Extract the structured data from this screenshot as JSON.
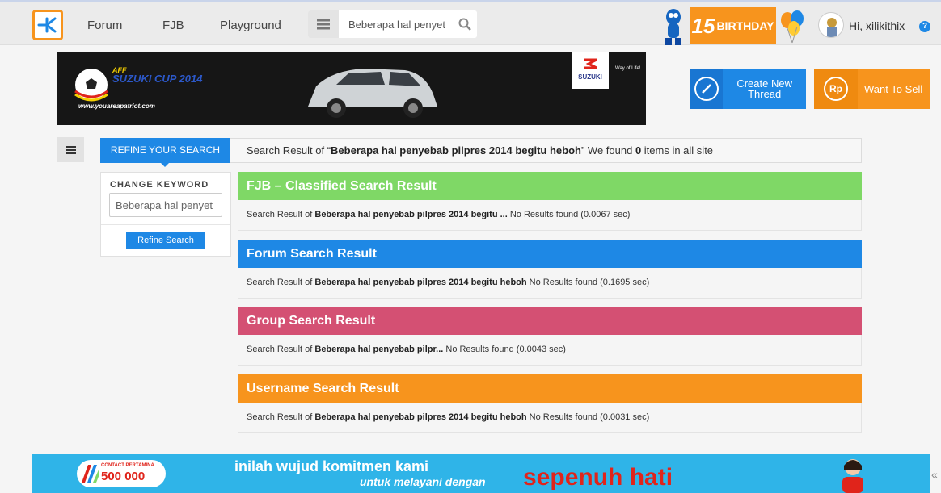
{
  "nav": {
    "links": [
      "Forum",
      "FJB",
      "Playground"
    ],
    "search_value": "Beberapa hal penyet",
    "birthday_number": "15",
    "birthday_text": "BIRTHDAY",
    "greeting": "Hi, xilikithix",
    "help": "?"
  },
  "banner": {
    "aff": "AFF",
    "suzuki_cup": "SUZUKI CUP 2014",
    "site": "www.youareapatriot.com",
    "brand": "SUZUKI",
    "tagline": "Way of Life!"
  },
  "actions": {
    "create_thread": "Create New Thread",
    "sell_icon": "Rp",
    "want_to_sell": "Want To Sell"
  },
  "search": {
    "refine_tab": "REFINE YOUR SEARCH",
    "header_prefix": "Search Result of “",
    "query": "Beberapa hal penyebab pilpres 2014 begitu heboh",
    "header_mid": "” We found ",
    "count": "0",
    "header_suffix": " items in all site",
    "change_keyword_label": "CHANGE KEYWORD",
    "keyword_value": "Beberapa hal penyet",
    "refine_button": "Refine Search"
  },
  "results": [
    {
      "title": "FJB – Classified Search Result",
      "color": "#7fd866",
      "prefix": "Search Result of ",
      "query": "Beberapa hal penyebab pilpres 2014 begitu ...",
      "status": " No Results found (0.0067 sec)"
    },
    {
      "title": "Forum Search Result",
      "color": "#1e88e5",
      "prefix": "Search Result of ",
      "query": "Beberapa hal penyebab pilpres 2014 begitu heboh",
      "status": " No Results found (0.1695 sec)"
    },
    {
      "title": "Group Search Result",
      "color": "#d45073",
      "prefix": "Search Result of ",
      "query": "Beberapa hal penyebab pilpr...",
      "status": " No Results found (0.0043 sec)"
    },
    {
      "title": "Username Search Result",
      "color": "#f7941d",
      "prefix": "Search Result of ",
      "query": "Beberapa hal penyebab pilpres 2014 begitu heboh",
      "status": " No Results found (0.0031 sec)"
    }
  ],
  "bottom_ad": {
    "contact_label": "CONTACT PERTAMINA",
    "number": "500 000",
    "line1": "inilah wujud komitmen kami",
    "line2": "untuk melayani dengan",
    "big": "sepenuh hati",
    "arrow": "«"
  },
  "colors": {
    "accent_blue": "#1e88e5",
    "accent_orange": "#f7941d"
  }
}
